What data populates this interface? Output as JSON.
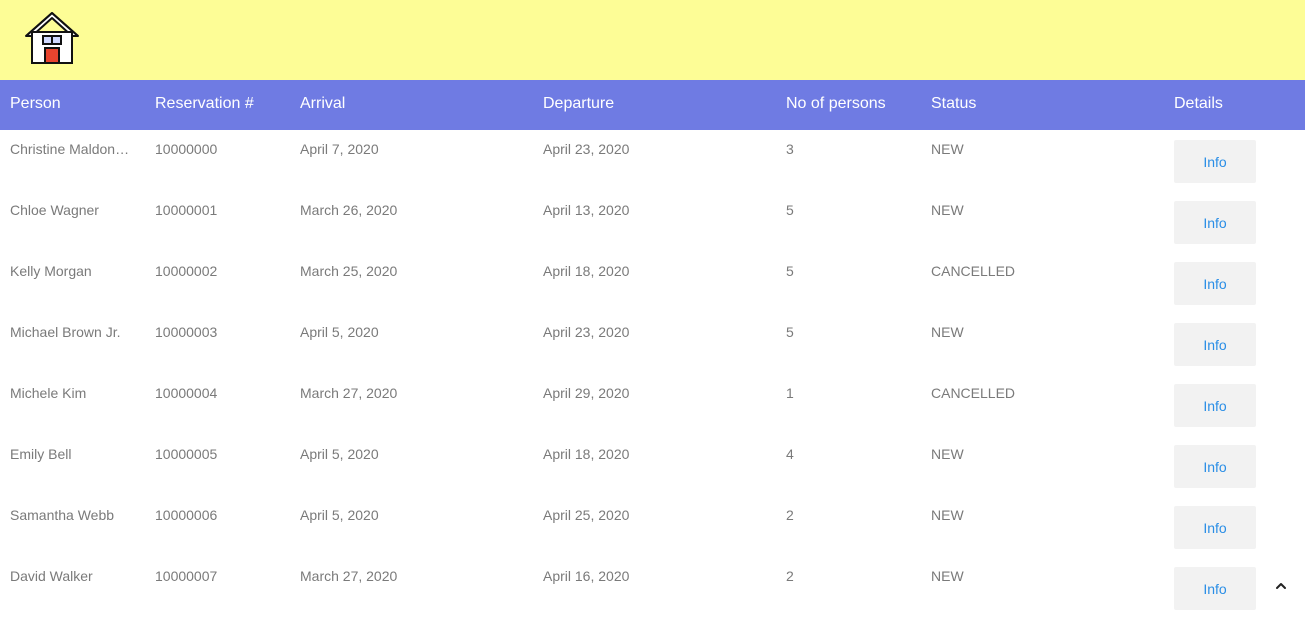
{
  "header": {
    "logo_icon": "house-icon"
  },
  "table": {
    "columns": [
      "Person",
      "Reservation #",
      "Arrival",
      "Departure",
      "No of persons",
      "Status",
      "Details"
    ],
    "rows": [
      {
        "person": "Christine Maldonado",
        "reservation": "10000000",
        "arrival": "April 7, 2020",
        "departure": "April 23, 2020",
        "persons": "3",
        "status": "NEW",
        "details": "Info"
      },
      {
        "person": "Chloe Wagner",
        "reservation": "10000001",
        "arrival": "March 26, 2020",
        "departure": "April 13, 2020",
        "persons": "5",
        "status": "NEW",
        "details": "Info"
      },
      {
        "person": "Kelly Morgan",
        "reservation": "10000002",
        "arrival": "March 25, 2020",
        "departure": "April 18, 2020",
        "persons": "5",
        "status": "CANCELLED",
        "details": "Info"
      },
      {
        "person": "Michael Brown Jr.",
        "reservation": "10000003",
        "arrival": "April 5, 2020",
        "departure": "April 23, 2020",
        "persons": "5",
        "status": "NEW",
        "details": "Info"
      },
      {
        "person": "Michele Kim",
        "reservation": "10000004",
        "arrival": "March 27, 2020",
        "departure": "April 29, 2020",
        "persons": "1",
        "status": "CANCELLED",
        "details": "Info"
      },
      {
        "person": "Emily Bell",
        "reservation": "10000005",
        "arrival": "April 5, 2020",
        "departure": "April 18, 2020",
        "persons": "4",
        "status": "NEW",
        "details": "Info"
      },
      {
        "person": "Samantha Webb",
        "reservation": "10000006",
        "arrival": "April 5, 2020",
        "departure": "April 25, 2020",
        "persons": "2",
        "status": "NEW",
        "details": "Info"
      },
      {
        "person": "David Walker",
        "reservation": "10000007",
        "arrival": "March 27, 2020",
        "departure": "April 16, 2020",
        "persons": "2",
        "status": "NEW",
        "details": "Info"
      }
    ]
  },
  "scroll_top_icon": "chevron-up-icon",
  "colors": {
    "topbar": "#fdfd96",
    "header": "#6f7be3",
    "link": "#2a8ee6"
  }
}
